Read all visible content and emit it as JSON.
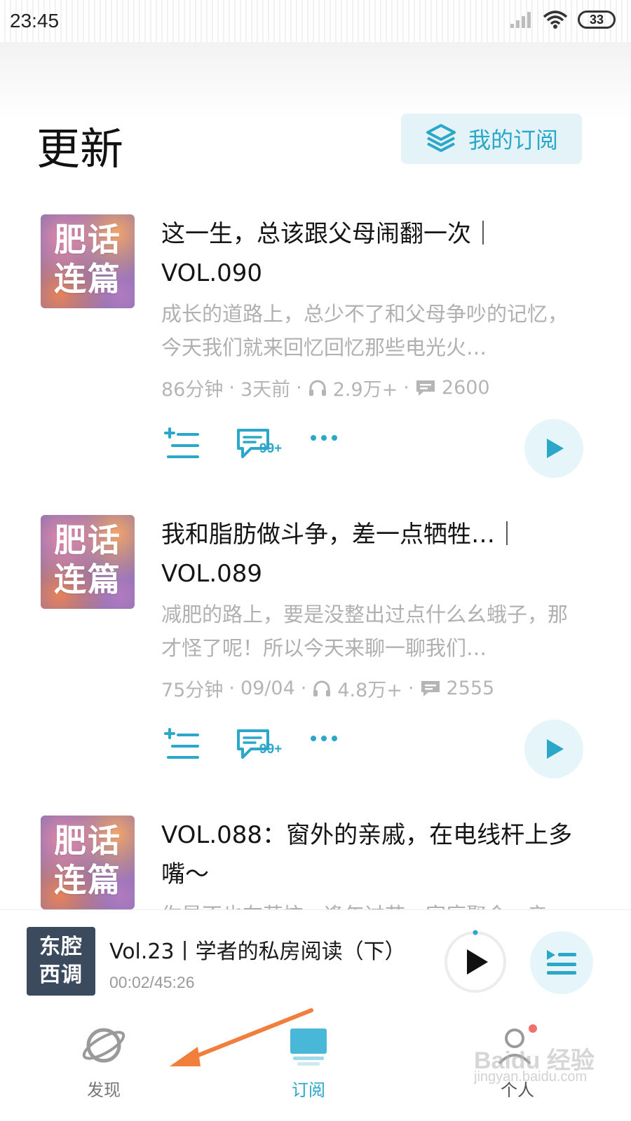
{
  "status_bar": {
    "time": "23:45",
    "battery": "33"
  },
  "header": {
    "title": "更新",
    "subscribe_button": "我的订阅"
  },
  "episodes": [
    {
      "cover_text": "肥话连篇",
      "title": "这一生，总该跟父母闹翻一次｜VOL.090",
      "desc": "成长的道路上，总少不了和父母争吵的记忆，今天我们就来回忆回忆那些电光火…",
      "duration": "86分钟",
      "date": "3天前",
      "plays": "2.9万+",
      "comments": "2600",
      "comment_badge": "99+"
    },
    {
      "cover_text": "肥话连篇",
      "title": "我和脂肪做斗争，差一点牺牲…｜VOL.089",
      "desc": "减肥的路上，要是没整出过点什么幺蛾子，那才怪了呢！所以今天来聊一聊我们…",
      "duration": "75分钟",
      "date": "09/04",
      "plays": "4.8万+",
      "comments": "2555",
      "comment_badge": "99+"
    },
    {
      "cover_text": "肥话连篇",
      "title": "VOL.088：窗外的亲戚，在电线杆上多嘴～",
      "desc": "你是不也在苦恼，逢年过节，家庭聚会，亲"
    }
  ],
  "player": {
    "cover_text": "东腔西调",
    "title": "Vol.23丨学者的私房阅读（下）",
    "time": "00:02/45:26",
    "progress": 0.001
  },
  "nav": {
    "discover": "发现",
    "subscribe": "订阅",
    "profile": "个人",
    "active": "subscribe"
  },
  "watermark": {
    "brand": "Baidu 经验",
    "url": "jingyan.baidu.com"
  },
  "colors": {
    "accent": "#2aa7c9",
    "arrow": "#f07f3c"
  }
}
